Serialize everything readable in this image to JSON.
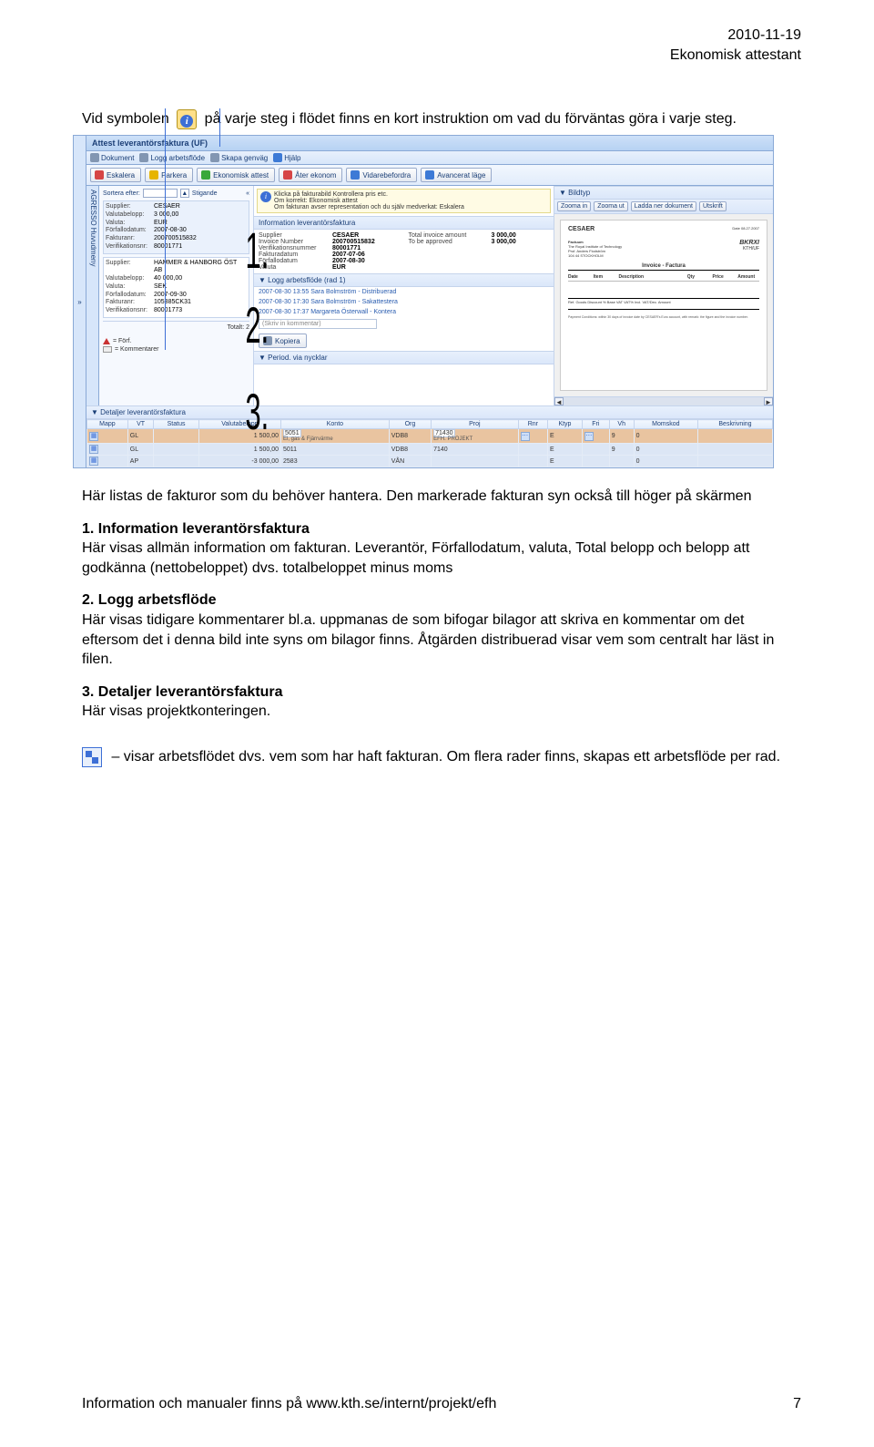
{
  "header": {
    "date": "2010-11-19",
    "title": "Ekonomisk attestant"
  },
  "intro": {
    "part1": "Vid symbolen",
    "part2": "på varje steg i flödet finns en kort instruktion om vad du förväntas göra i varje steg."
  },
  "screenshot": {
    "window_title": "Attest leverantörsfaktura (UF)",
    "side_tab": "AGRESSO Huvudmeny",
    "menubar": [
      "Dokument",
      "Logg arbetsflöde",
      "Skapa genväg",
      "Hjälp"
    ],
    "toolbar": [
      "Eskalera",
      "Parkera",
      "Ekonomisk attest",
      "Åter ekonom",
      "Vidarebefordra",
      "Avancerat läge"
    ],
    "sort_label": "Sortera efter:",
    "sort_dir": "Stigande",
    "invoices": [
      {
        "Supplier": "CESAER",
        "Valutabelopp": "3 000,00",
        "Valuta": "EUR",
        "Förfallodatum": "2007-08-30",
        "Fakturanr": "200700515832",
        "Verifikationsnr": "80001771",
        "selected": true
      },
      {
        "Supplier": "HAMMER & HANBORG ÖST AB",
        "Valutabelopp": "40 000,00",
        "Valuta": "SEK",
        "Förfallodatum": "2007-09-30",
        "Fakturanr": "105385CK31",
        "Verifikationsnr": "80001773",
        "selected": false
      }
    ],
    "totalt_label": "Totalt: 2",
    "legend": [
      {
        "icon": "warn",
        "text": "= Förf."
      },
      {
        "icon": "comment",
        "text": "= Kommentarer"
      }
    ],
    "hint_lines": [
      "Klicka på fakturabild Kontrollera pris etc.",
      "Om korrekt: Ekonomisk attest",
      "Om fakturan avser representation och du själv medverkat: Eskalera"
    ],
    "info_panel": {
      "title": "Information leverantörsfaktura",
      "rows_left": [
        [
          "Supplier",
          "CESAER"
        ],
        [
          "Invoice Number",
          "200700515832"
        ],
        [
          "Verifikationsnummer",
          "80001771"
        ],
        [
          "Fakturadatum",
          "2007-07-06"
        ],
        [
          "Förfallodatum",
          "2007-08-30"
        ],
        [
          "Valuta",
          "EUR"
        ]
      ],
      "rows_right": [
        [
          "Total invoice amount",
          "3 000,00"
        ],
        [
          "To be approved",
          "3 000,00"
        ]
      ]
    },
    "log_panel": {
      "title": "Logg arbetsflöde (rad 1)",
      "entries": [
        "2007-08-30 13:55 Sara Bolmström - Distribuerad",
        "2007-08-30 17:30 Sara Bolmström - Sakattestera",
        "2007-08-30 17:37 Margareta Österwall - Kontera"
      ],
      "comment_placeholder": "(Skriv in kommentar)",
      "copy_label": "Kopiera"
    },
    "period_panel": "Period. via nycklar",
    "image_panel": {
      "title": "Bildtyp",
      "toolbar": [
        "Zooma in",
        "Zooma ut",
        "Ladda ner dokument",
        "Utskrift"
      ],
      "supplier": "CESAER",
      "addr": [
        "The Royal Institute of Technology",
        "Prof. Anders Flodström",
        "104 44  STOCKHOLM"
      ],
      "stamp_left": "BKRXI",
      "stamp_right": "KTH/UF",
      "stamp_date": "08.27.2007",
      "inv_title": "Invoice - Factura",
      "cols": [
        "Date",
        "Item",
        "Description",
        "Qty",
        "Price",
        "Amount"
      ],
      "note1": "Ref. Goods    Discount    %    Base VAT    VAT%    Incl. VAT/Dec. Amount",
      "para": "Payment Conditions: within 30 days of invoice date by CESAER's Euro account, with remark: the figure and the invoice number."
    },
    "details": {
      "title": "Detaljer leverantörsfaktura",
      "headers": [
        "Mapp",
        "VT",
        "Status",
        "Valutabelopp",
        "Konto",
        "Org",
        "Proj",
        "Rnr",
        "Ktyp",
        "Fri",
        "Vh",
        "Momskod",
        "Beskrivning"
      ],
      "rows": [
        {
          "hl": true,
          "vt": "GL",
          "belopp": "1 500,00",
          "konto": "5051",
          "org": "VDB8",
          "proj": "71430",
          "rnr": "",
          "ktyp": "E",
          "vh": "9",
          "moms": "0",
          "desc_sub": "El, gas & Fjärrvärme",
          "proj_sub": "EFH. PROJEKT"
        },
        {
          "hl": false,
          "vt": "GL",
          "belopp": "1 500,00",
          "konto": "5011",
          "org": "VDB8",
          "proj": "7140",
          "rnr": "",
          "ktyp": "E",
          "vh": "9",
          "moms": "0"
        },
        {
          "hl": false,
          "vt": "AP",
          "belopp": "-3 000,00",
          "konto": "2583",
          "org": "VÅN",
          "proj": "",
          "rnr": "",
          "ktyp": "E",
          "vh": "",
          "moms": "0"
        }
      ]
    }
  },
  "numbers": {
    "n1": "1.",
    "n2": "2.",
    "n3": "3."
  },
  "body": {
    "p1": "Här listas de fakturor som du behöver hantera. Den markerade fakturan syn också till höger på skärmen",
    "h1": "1. Information leverantörsfaktura",
    "p2": "Här visas allmän information om fakturan. Leverantör, Förfallodatum, valuta, Total belopp och belopp att godkänna (nettobeloppet) dvs. totalbeloppet minus moms",
    "h2": "2. Logg arbetsflöde",
    "p3": "Här visas tidigare kommentarer bl.a. uppmanas de som bifogar bilagor att skriva en kommentar om det eftersom det i denna bild inte syns om bilagor finns. Åtgärden distribuerad visar vem som centralt har läst in filen.",
    "h3": "3. Detaljer leverantörsfaktura",
    "p4": "Här visas projektkonteringen.",
    "p5": " – visar arbetsflödet dvs. vem som har haft fakturan. Om flera rader finns, skapas ett arbetsflöde per rad."
  },
  "footer": {
    "left": "Information och manualer finns på www.kth.se/internt/projekt/efh",
    "right": "7"
  }
}
